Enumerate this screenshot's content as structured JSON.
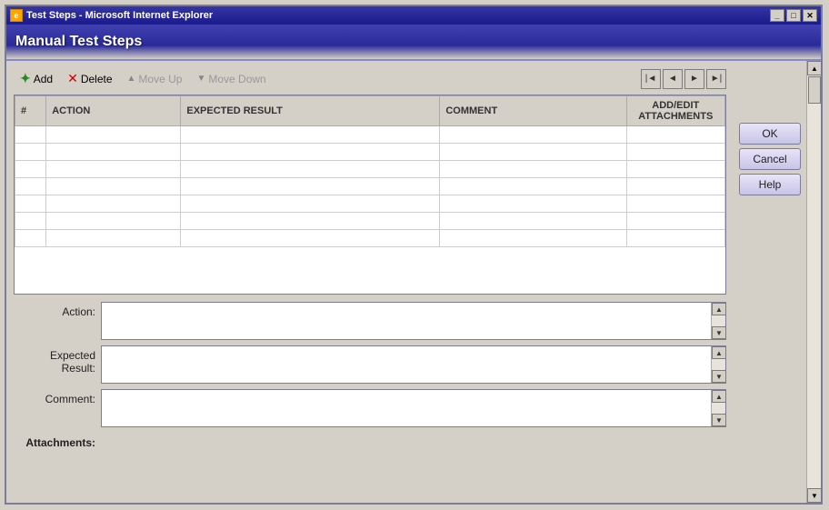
{
  "window": {
    "title": "Test Steps - Microsoft Internet Explorer",
    "title_icon": "IE",
    "controls": [
      "_",
      "□",
      "X"
    ]
  },
  "header": {
    "title": "Manual Test Steps"
  },
  "toolbar": {
    "add_label": "Add",
    "delete_label": "Delete",
    "move_up_label": "Move Up",
    "move_down_label": "Move Down"
  },
  "table": {
    "columns": [
      "#",
      "ACTION",
      "EXPECTED RESULT",
      "COMMENT",
      "ADD/EDIT\nATTACHMENTS"
    ],
    "rows": []
  },
  "form": {
    "action_label": "Action:",
    "expected_result_label": "Expected Result:",
    "comment_label": "Comment:",
    "attachments_label": "Attachments:",
    "action_value": "",
    "expected_result_value": "",
    "comment_value": ""
  },
  "buttons": {
    "ok_label": "OK",
    "cancel_label": "Cancel",
    "help_label": "Help"
  },
  "nav": {
    "first_title": "First",
    "prev_title": "Previous",
    "next_title": "Next",
    "last_title": "Last"
  }
}
